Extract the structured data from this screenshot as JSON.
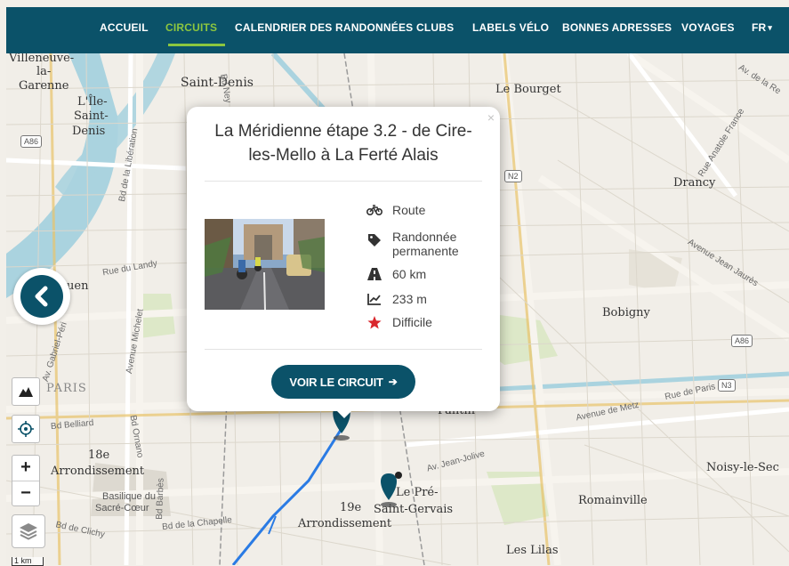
{
  "nav": {
    "items": [
      {
        "label": "ACCUEIL",
        "active": false
      },
      {
        "label": "CIRCUITS",
        "active": true
      },
      {
        "label": "CALENDRIER DES RANDONNÉES",
        "active": false
      },
      {
        "label": "CLUBS",
        "active": false
      },
      {
        "label": "LABELS VÉLO",
        "active": false
      },
      {
        "label": "BONNES ADRESSES",
        "active": false
      },
      {
        "label": "VOYAGES",
        "active": false
      }
    ],
    "language": "FR",
    "language_caret": "▾",
    "accent_color": "#8cc63f",
    "bar_color": "#0b5269"
  },
  "map": {
    "places": {
      "villeneuve": "Villeneuve-",
      "la": "la-",
      "garenne": "Garenne",
      "lile1": "L'Île-",
      "lile2": "Saint-",
      "lile3": "Denis",
      "saint_denis": "Saint-Denis",
      "le_bourget": "Le Bourget",
      "drancy": "Drancy",
      "bobigny": "Bobigny",
      "ouen": "uen",
      "paris": "PARIS",
      "pantin": "Pantin",
      "arr18a": "18e",
      "arr18b": "Arrondissement",
      "sacre1": "Basilique du",
      "sacre2": "Sacré-Cœur",
      "le_pre1": "Le Pré-",
      "le_pre2": "Saint-Gervais",
      "arr19a": "19e",
      "arr19b": "Arrondissement",
      "romainville": "Romainville",
      "noisy": "Noisy-le-Sec",
      "les_lilas": "Les Lilas"
    },
    "roads": {
      "r1": "Av. de la Re",
      "r2": "Rue du Landy",
      "r3": "Avenue Michelet",
      "r4": "Av. Gabriel-Péri",
      "r5": "Bd Belliard",
      "r6": "Bd Ornano",
      "r7": "Bd Barbès",
      "r8": "Bd de la Chapelle",
      "r9": "Bd de Clichy",
      "r10": "Av. Jean-Jolive",
      "r11": "Avenue de Metz",
      "r12": "Rue de Paris",
      "r13": "Avenue Jean Jaurès",
      "r14": "Rue Anatole France",
      "r15": "Bd de la Libération",
      "r16": "Bd Ney"
    },
    "shields": {
      "a86_left": "A86",
      "a86_right": "A86",
      "n2": "N2",
      "n3": "N3"
    },
    "scale_label": "1 km"
  },
  "controls": {
    "back_icon": "chevron-left-icon",
    "elevation_icon": "mountain-icon",
    "locate_icon": "crosshair-icon",
    "zoom_in": "+",
    "zoom_out": "−",
    "layers_icon": "layers-icon"
  },
  "popup": {
    "close": "×",
    "title": "La Méridienne étape 3.2 - de Cire-les-Mello à La Ferté Alais",
    "attributes": [
      {
        "icon": "bicycle-icon",
        "label": "Route"
      },
      {
        "icon": "tag-icon",
        "label": "Randonnée permanente"
      },
      {
        "icon": "road-icon",
        "label": "60 km"
      },
      {
        "icon": "elevation-icon",
        "label": "233 m"
      },
      {
        "icon": "star-icon",
        "label": "Difficile",
        "color": "#d9262c"
      }
    ],
    "cta_label": "VOIR LE CIRCUIT",
    "cta_arrow": "➔"
  }
}
